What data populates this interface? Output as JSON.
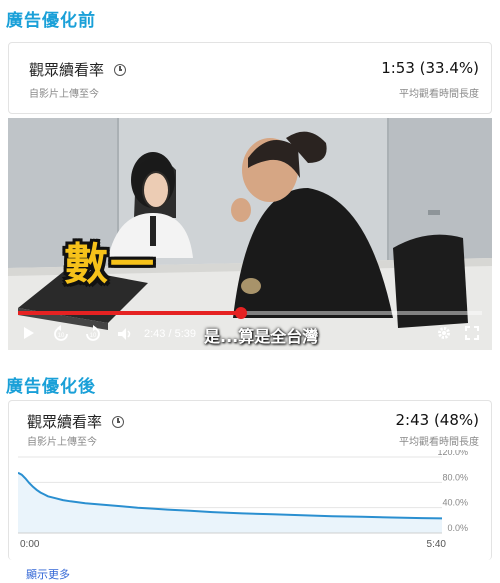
{
  "sections": {
    "before_title": "廣告優化前",
    "after_title": "廣告優化後"
  },
  "before": {
    "metric_name": "觀眾續看率",
    "metric_sub": "自影片上傳至今",
    "value": "1:53 (33.4%)",
    "value_sub": "平均觀看時間長度"
  },
  "video": {
    "time": "2:43 / 5:39",
    "progress": 0.481,
    "subtitle": "是...算是全台灣",
    "caption": "數一"
  },
  "after": {
    "metric_name": "觀眾續看率",
    "metric_sub": "自影片上傳至今",
    "value": "2:43 (48%)",
    "value_sub": "平均觀看時間長度"
  },
  "chart_data": {
    "type": "line",
    "x_start_label": "0:00",
    "x_end_label": "5:40",
    "x": [
      0,
      0.05,
      0.1,
      0.15,
      0.2,
      0.25,
      0.3,
      0.35,
      0.4,
      0.5,
      0.6,
      0.7,
      0.8,
      0.9,
      1.0,
      1.2,
      1.4,
      1.6,
      1.8,
      2.0,
      2.3,
      2.6,
      3.0,
      3.4,
      3.8,
      4.2,
      4.6,
      5.0,
      5.4,
      5.667
    ],
    "values": [
      95,
      92,
      86,
      79,
      73,
      68,
      64,
      61,
      58,
      55,
      52,
      50,
      48.5,
      47,
      46,
      44,
      42,
      40,
      38.5,
      37,
      35,
      33,
      31,
      29.5,
      28,
      26.5,
      25.5,
      24.5,
      23.5,
      23
    ],
    "yticks": [
      "120.0%",
      "80.0%",
      "40.0%",
      "0.0%"
    ],
    "ylim": [
      0,
      120
    ],
    "line_color": "#2a8fd0"
  },
  "footer": {
    "more_label": "顯示更多"
  }
}
